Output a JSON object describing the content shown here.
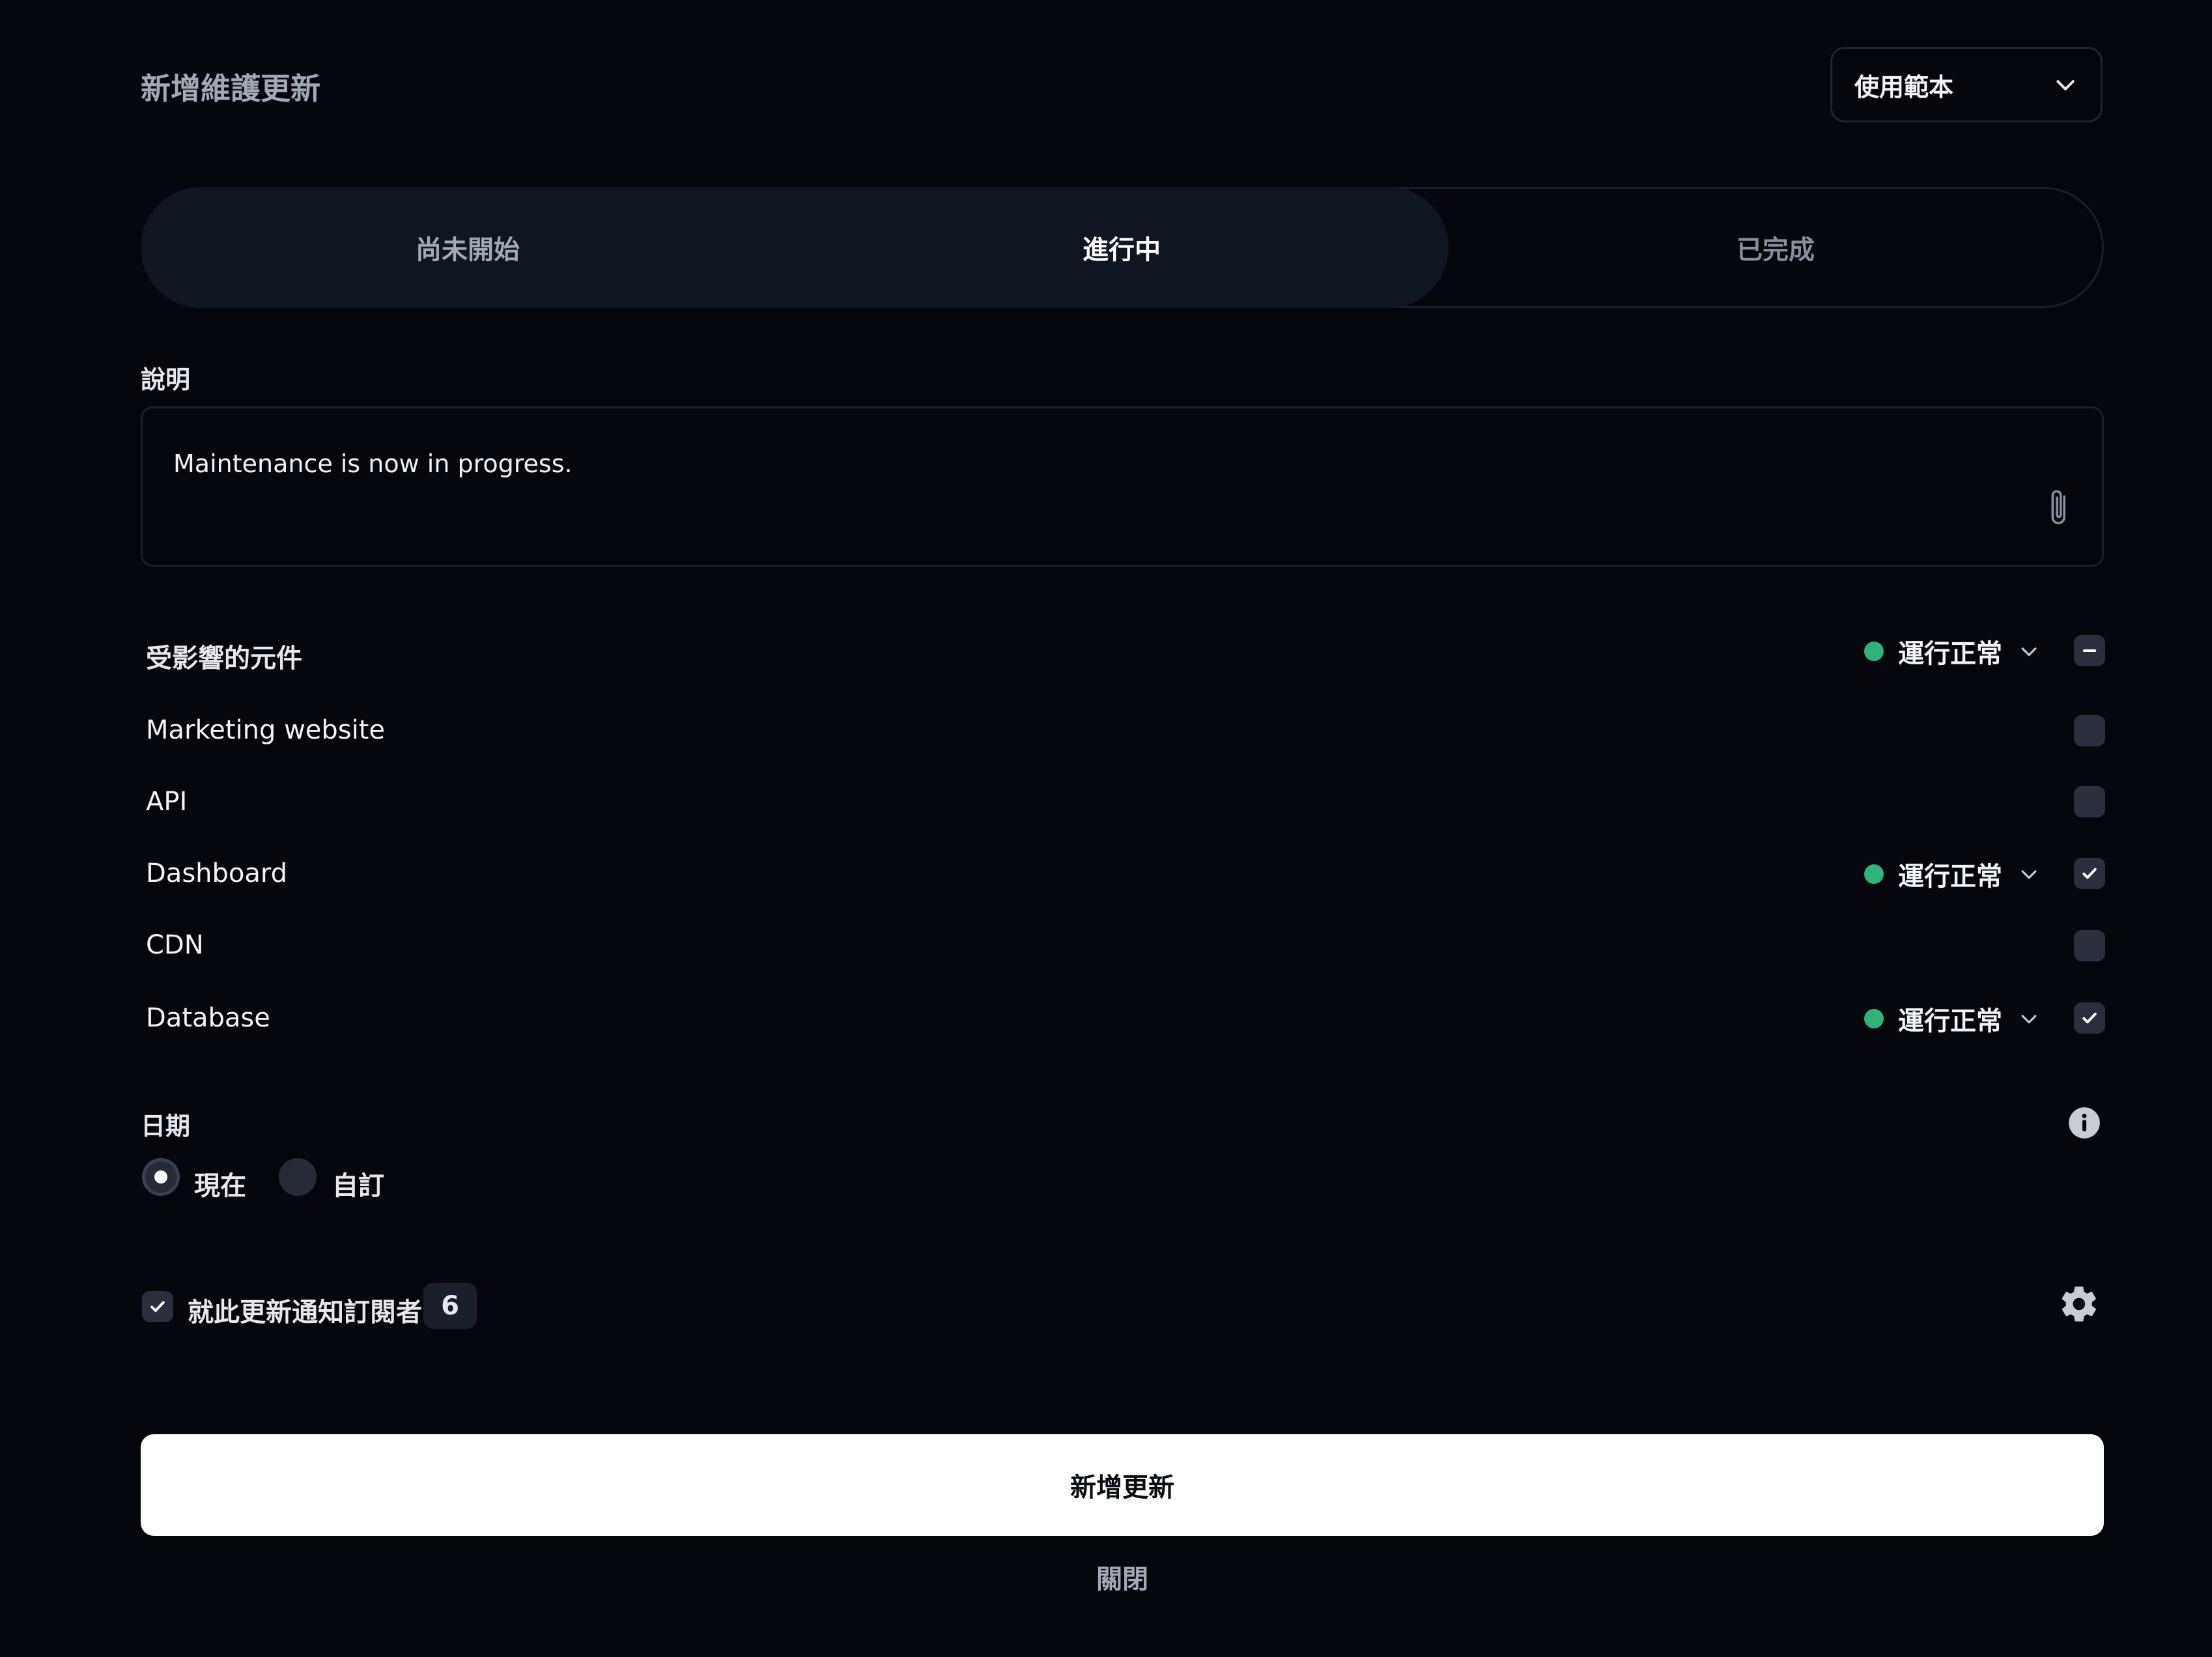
{
  "header": {
    "title": "新增維護更新",
    "template_button_label": "使用範本"
  },
  "status_tabs": {
    "items": [
      {
        "label": "尚未開始",
        "state": "inactive"
      },
      {
        "label": "進行中",
        "state": "selected"
      },
      {
        "label": "已完成",
        "state": "inactive"
      }
    ]
  },
  "description": {
    "label": "說明",
    "value": "Maintenance is now in progress."
  },
  "components": {
    "heading": "受影響的元件",
    "bulk_status": "運行正常",
    "rows": [
      {
        "name": "Marketing website",
        "checked": false
      },
      {
        "name": "API",
        "checked": false
      },
      {
        "name": "Dashboard",
        "checked": true,
        "status": "運行正常"
      },
      {
        "name": "CDN",
        "checked": false
      },
      {
        "name": "Database",
        "checked": true,
        "status": "運行正常"
      }
    ]
  },
  "date": {
    "label": "日期",
    "options": [
      {
        "label": "現在",
        "selected": true
      },
      {
        "label": "自訂",
        "selected": false
      }
    ]
  },
  "notify": {
    "label": "就此更新通知訂閱者",
    "count": "6",
    "checked": true
  },
  "actions": {
    "submit_label": "新增更新",
    "close_label": "關閉"
  },
  "colors": {
    "background": "#05070d",
    "status_ok": "#2fb37a",
    "primary_button": "#ffffff"
  },
  "icons": [
    "chevron-down-icon",
    "paperclip-icon",
    "minus-icon",
    "check-icon",
    "info-icon",
    "gear-icon"
  ]
}
